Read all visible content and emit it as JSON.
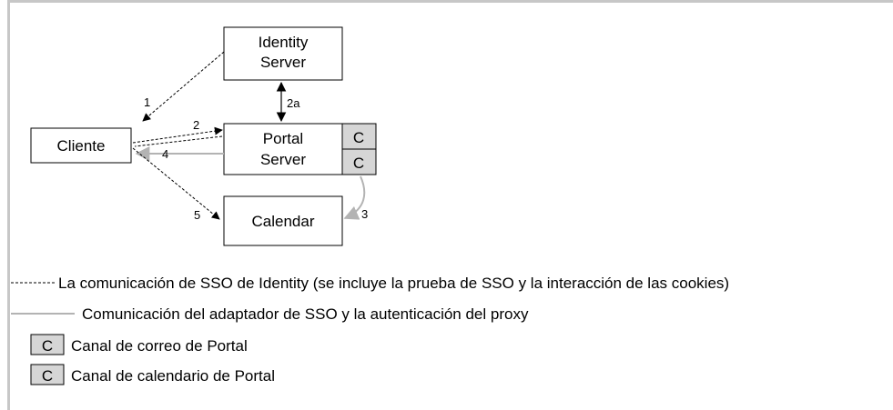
{
  "nodes": {
    "identity_server": {
      "line1": "Identity",
      "line2": "Server"
    },
    "cliente": "Cliente",
    "portal_server": {
      "line1": "Portal",
      "line2": "Server"
    },
    "calendar": "Calendar",
    "channel_mail": "C",
    "channel_calendar": "C"
  },
  "arrows": {
    "a1": "1",
    "a2": "2",
    "a2a": "2a",
    "a3": "3",
    "a4": "4",
    "a5": "5"
  },
  "legend": {
    "sso_identity": "La comunicación de SSO de Identity (se incluye la prueba de SSO y la interacción de las cookies)",
    "adapter_proxy": "Comunicación del adaptador de SSO y la autenticación del proxy",
    "mail_channel_symbol": "C",
    "mail_channel": "Canal de correo de Portal",
    "calendar_channel_symbol": "C",
    "calendar_channel": "Canal de calendario de Portal"
  },
  "colors": {
    "dashed_line": "#000000",
    "solid_line": "#b3b3b3",
    "channel_fill": "#d6d6d6",
    "frame": "#c7c7c7"
  }
}
